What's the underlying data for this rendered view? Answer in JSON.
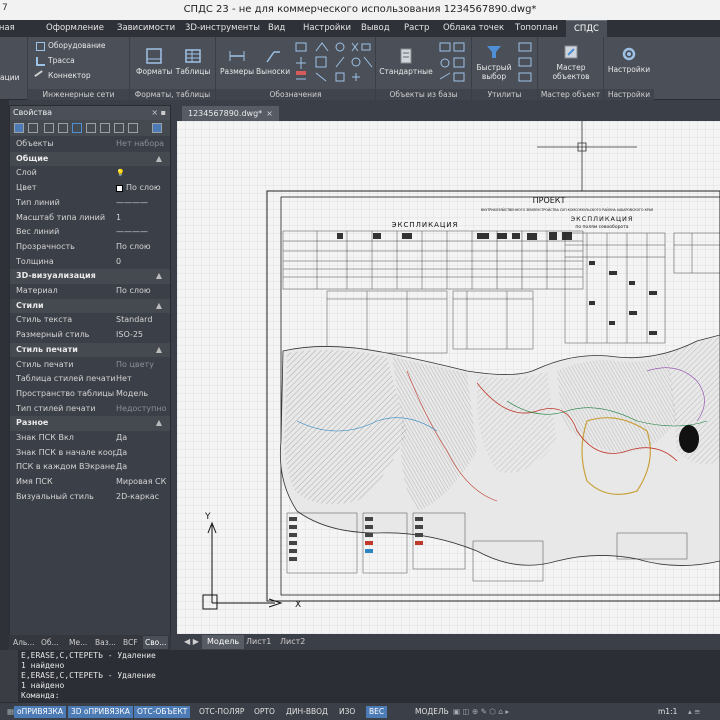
{
  "app": {
    "title": "СПДС 23 - не для коммерческого использования 1234567890.dwg*",
    "qat_label": "7"
  },
  "ribbon_tabs": [
    "Главная",
    "Оформление",
    "Зависимости",
    "3D-инструменты",
    "Вид",
    "Настройки",
    "Вывод",
    "Растр",
    "Облака точек",
    "Топоплан",
    "СПДС"
  ],
  "ribbon_active_tab": "СПДС",
  "ribbon": {
    "groups": [
      {
        "title": "",
        "buttons": [
          "ации"
        ]
      },
      {
        "title": "Инженерные сети",
        "buttons": [
          "Оборудование",
          "Трасса",
          "Коннектор"
        ]
      },
      {
        "title": "Форматы, таблицы",
        "buttons": [
          "Форматы",
          "Таблицы"
        ]
      },
      {
        "title": "Обозначения",
        "buttons": [
          "Размеры",
          "Выноски"
        ]
      },
      {
        "title": "Объекты из базы",
        "buttons": [
          "Стандартные"
        ]
      },
      {
        "title": "Утилиты",
        "buttons": [
          "Быстрый выбор"
        ]
      },
      {
        "title": "Мастер объект",
        "buttons": [
          "Мастер объектов"
        ]
      },
      {
        "title": "Настройки",
        "buttons": [
          "Настройки"
        ]
      }
    ]
  },
  "properties": {
    "title": "Свойства",
    "rows": [
      {
        "type": "row",
        "key": "Объекты",
        "value": "Нет набора",
        "dim": true
      },
      {
        "type": "section",
        "key": "Общие"
      },
      {
        "type": "row",
        "key": "Слой",
        "value": "",
        "dim": false
      },
      {
        "type": "row",
        "key": "Цвет",
        "value": "По слою",
        "dim": false
      },
      {
        "type": "row",
        "key": "Тип линий",
        "value": "————",
        "dim": false
      },
      {
        "type": "row",
        "key": "Масштаб типа линий",
        "value": "1",
        "dim": false
      },
      {
        "type": "row",
        "key": "Вес линий",
        "value": "————",
        "dim": false
      },
      {
        "type": "row",
        "key": "Прозрачность",
        "value": "По слою",
        "dim": false
      },
      {
        "type": "row",
        "key": "Толщина",
        "value": "0",
        "dim": false
      },
      {
        "type": "section",
        "key": "3D-визуализация"
      },
      {
        "type": "row",
        "key": "Материал",
        "value": "По слою",
        "dim": false
      },
      {
        "type": "section",
        "key": "Стили"
      },
      {
        "type": "row",
        "key": "Стиль текста",
        "value": "Standard",
        "dim": false
      },
      {
        "type": "row",
        "key": "Размерный стиль",
        "value": "ISO-25",
        "dim": false
      },
      {
        "type": "section",
        "key": "Стиль печати"
      },
      {
        "type": "row",
        "key": "Стиль печати",
        "value": "По цвету",
        "dim": true
      },
      {
        "type": "row",
        "key": "Таблица стилей печати",
        "value": "Нет",
        "dim": false
      },
      {
        "type": "row",
        "key": "Пространство таблицы с...",
        "value": "Модель",
        "dim": false
      },
      {
        "type": "row",
        "key": "Тип стилей печати",
        "value": "Недоступно",
        "dim": true
      },
      {
        "type": "section",
        "key": "Разное"
      },
      {
        "type": "row",
        "key": "Знак ПСК Вкл",
        "value": "Да",
        "dim": false
      },
      {
        "type": "row",
        "key": "Знак ПСК в начале коор...",
        "value": "Да",
        "dim": false
      },
      {
        "type": "row",
        "key": "ПСК в каждом ВЭкране",
        "value": "Да",
        "dim": false
      },
      {
        "type": "row",
        "key": "Имя ПСК",
        "value": "Мировая СК",
        "dim": false
      },
      {
        "type": "row",
        "key": "Визуальный стиль",
        "value": "2D-каркас",
        "dim": false
      }
    ],
    "tabs": [
      "Аль...",
      "Об...",
      "Ме...",
      "Ваз...",
      "BCF",
      "Сво..."
    ],
    "active_tab": "Сво..."
  },
  "document": {
    "tab_label": "1234567890.dwg*"
  },
  "layout_tabs": [
    "Модель",
    "Лист1",
    "Лист2"
  ],
  "layout_active": "Модель",
  "drawing": {
    "title": "ПРОЕКТ",
    "subtitle": "ВНУТРИХОЗЯЙСТВЕННОГО ЗЕМЛЕУСТРОЙСТВА СХП КОМСОМОЛЬСКОГО РАЙОНА ХАБАРОВСКОГО КРАЯ",
    "explication_title": "ЭКСПЛИКАЦИЯ",
    "explication2_title": "ЭКСПЛИКАЦИЯ",
    "explication2_sub": "по полям севооборота",
    "ucs_y": "Y",
    "ucs_x": "X"
  },
  "command_line": {
    "lines": [
      "E,ERASE,C,СТЕРЕТЬ - Удаление",
      "1 найдено",
      "E,ERASE,C,СТЕРЕТЬ - Удаление",
      "1 найдено",
      "Команда:"
    ]
  },
  "status_bar": [
    {
      "label": "оПРИВЯЗКА",
      "on": true
    },
    {
      "label": "3D оПРИВЯЗКА",
      "on": true
    },
    {
      "label": "ОТС-ОБЪЕКТ",
      "on": true
    },
    {
      "label": "ОТС-ПОЛЯР",
      "on": false
    },
    {
      "label": "ОРТО",
      "on": false
    },
    {
      "label": "ДИН-ВВОД",
      "on": false
    },
    {
      "label": "ИЗО",
      "on": false
    },
    {
      "label": "ВЕС",
      "on": true
    },
    {
      "label": "МОДЕЛЬ",
      "on": false
    },
    {
      "label": "m1:1",
      "on": false
    }
  ]
}
